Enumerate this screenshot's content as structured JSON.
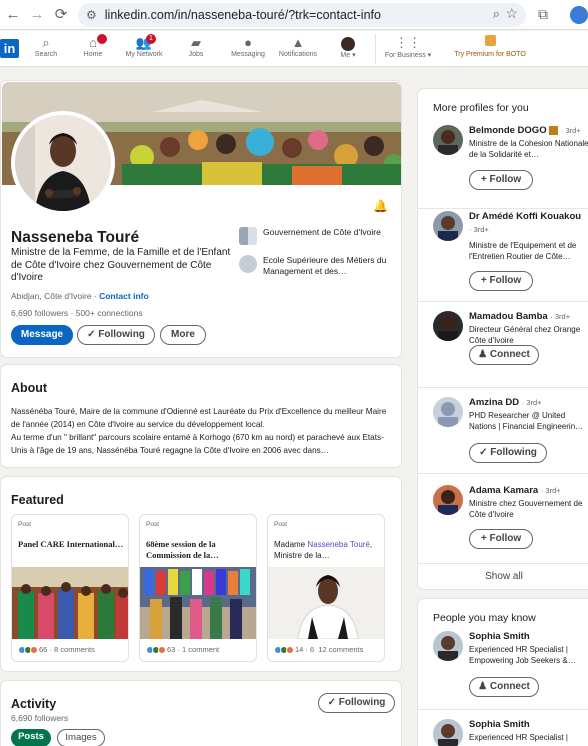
{
  "browser": {
    "url": "linkedin.com/in/nasseneba-touré/?trk=contact-info"
  },
  "nav": {
    "logo": "in",
    "items": [
      {
        "label": "Search",
        "icon": "search-icon"
      },
      {
        "label": "Home",
        "icon": "home-icon"
      },
      {
        "label": "My Network",
        "icon": "network-icon",
        "badge": "1"
      },
      {
        "label": "Jobs",
        "icon": "briefcase-icon"
      },
      {
        "label": "Messaging",
        "icon": "message-icon"
      },
      {
        "label": "Notifications",
        "icon": "bell-icon"
      },
      {
        "label": "Me ▾",
        "icon": "avatar"
      },
      {
        "label": "For Business ▾",
        "icon": "grid-icon"
      }
    ],
    "premium": "Try Premium for BOTO"
  },
  "profile": {
    "name": "Nasseneba Touré",
    "headline": "Ministre de la Femme, de la Famille et de l'Enfant de Côte d'Ivoire chez Gouvernement de Côte d'Ivoire",
    "location": "Abidjan, Côte d'Ivoire",
    "contact_sep": " · ",
    "contact_info": "Contact info",
    "stats": "6,690 followers · 500+ connections",
    "buttons": {
      "message": "Message",
      "following": "✓ Following",
      "more": "More"
    },
    "orgs": [
      "Gouvernement de Côte d'Ivoire",
      "Ecole Supérieure des Métiers du Management et des…"
    ]
  },
  "about": {
    "title": "About",
    "text_1": "Nassénéba Touré, Maire de la commune d'Odienné est Lauréate du Prix d'Excellence du meilleur Maire de l'année (2014) en Côte d'Ivoire au service du développement local.",
    "text_2": "Au terme d'un \" brillant\" parcours scolaire entamé à Korhogo (670 km au nord) et parachevé aux Etats-Unis à l'âge de 19 ans, Nassénéba Touré regagne la Côte d'Ivoire en 2006 avec dans…"
  },
  "featured": {
    "title": "Featured",
    "cards": [
      {
        "type": "Post",
        "title": "Panel CARE International…",
        "reactions": "66",
        "comments": "· 8 comments"
      },
      {
        "type": "Post",
        "title": "68ème session de la Commission de la…",
        "reactions": "63",
        "comments": "· 1 comment"
      },
      {
        "type": "Post",
        "title_prefix": "Madame ",
        "title_highlight": "Nasseneba Touré",
        "title_suffix": ", Ministre de la…",
        "reactions": "14 · 6",
        "comments": "12 comments"
      }
    ]
  },
  "activity": {
    "title": "Activity",
    "followers": "6,690 followers",
    "following": "✓ Following",
    "tabs": [
      "Posts",
      "Images"
    ]
  },
  "more_profiles": {
    "title": "More profiles for you",
    "people": [
      {
        "name": "Belmonde DOGO",
        "degree": "· 3rd+",
        "desc": "Ministre de la Cohesion Nationale , de la Solidarité et…",
        "button": "+ Follow"
      },
      {
        "name": "Dr Amédé Koffi Kouakou",
        "degree": "· 3rd+",
        "desc": "Ministre de l'Equipement et de l'Entretien Routier de Côte…",
        "button": "+ Follow"
      },
      {
        "name": "Mamadou Bamba",
        "degree": "· 3rd+",
        "desc": "Directeur Général chez Orange Côte d'Ivoire",
        "button": "Connect"
      },
      {
        "name": "Amzina DD",
        "degree": "· 3rd+",
        "desc": "PHD Researcher @ United Nations | Financial Engineerin…",
        "button": "✓ Following"
      },
      {
        "name": "Adama Kamara",
        "degree": "· 3rd+",
        "desc": "Ministre chez Gouvernement de Côte d'Ivoire",
        "button": "+ Follow"
      }
    ],
    "show_all": "Show all"
  },
  "people_you_may_know": {
    "title": "People you may know",
    "people": [
      {
        "name": "Sophia Smith",
        "desc": "Experienced HR Specialist | Empowering Job Seekers &…",
        "button": "Connect"
      },
      {
        "name": "Sophia Smith",
        "desc": "Experienced HR Specialist |",
        "button": ""
      }
    ]
  }
}
